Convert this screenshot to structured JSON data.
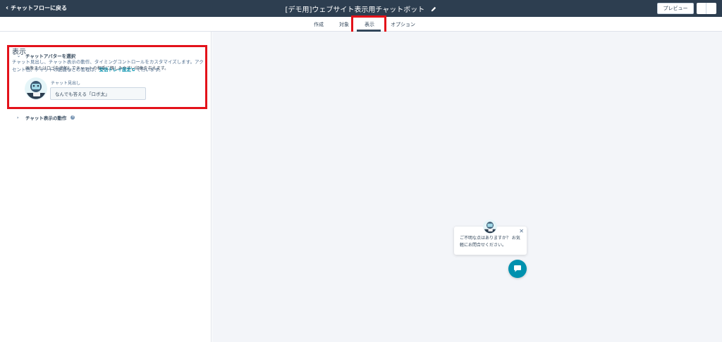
{
  "header": {
    "back_label": "チャットフローに戻る",
    "title": "[デモ用]ウェブサイト表示用チャットボット",
    "preview_label": "プレビュー"
  },
  "tabs": [
    {
      "label": "作成"
    },
    {
      "label": "対象"
    },
    {
      "label": "表示",
      "active": true
    },
    {
      "label": "オプション"
    }
  ],
  "panel": {
    "title": "表示",
    "description_before": "チャット見出し、チャット表示の動作、タイミングコントロールをカスタマイズします。アクセント色、チャットの配置などの管理は、",
    "description_link": "受信トレイ設定",
    "description_after": " で行います。",
    "avatar_section": {
      "header": "チャットアバターを選択",
      "description": "画像またはロゴを追加してチャットの相手に親しみやすい印象を与えます。",
      "field_label": "チャット見出し",
      "field_value": "なんでも答える「ロボ太」"
    },
    "behavior_section": {
      "header": "チャット表示の動作"
    }
  },
  "preview": {
    "welcome_message": "ご不明な点はありますか？ お気軽にお問合せください。"
  },
  "colors": {
    "topbar": "#2d3e50",
    "accent": "#0091ae",
    "highlight": "#e3121a"
  }
}
